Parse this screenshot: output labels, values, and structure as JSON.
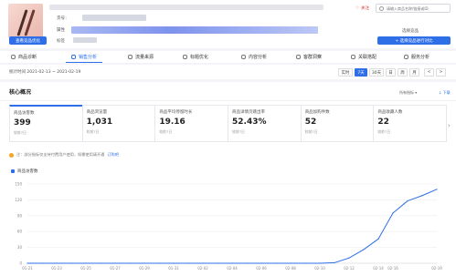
{
  "header": {
    "product_id_label": "货号：",
    "attr_label": "属性",
    "tag_label": "标签",
    "optimize_btn": "查看竞品优化",
    "follow": "关注",
    "search_placeholder": "请输入商品名称/链接或ID",
    "compare_label": "选择竞品",
    "add_compare_btn": "+ 选择竞品进行对比"
  },
  "tabs": [
    {
      "label": "商品诊断"
    },
    {
      "label": "销售分析",
      "active": true
    },
    {
      "label": "流量来源"
    },
    {
      "label": "标题优化"
    },
    {
      "label": "内容分析"
    },
    {
      "label": "客群洞察"
    },
    {
      "label": "关联搭配"
    },
    {
      "label": "服务分析"
    }
  ],
  "date_range": {
    "text": "统计时间 2021-02-13 ~ 2021-02-19",
    "chips": [
      "实时",
      "7天",
      "30天",
      "日",
      "周",
      "月",
      "<",
      ">"
    ],
    "selected": "7天"
  },
  "core": {
    "title": "核心概况",
    "all_metrics": "所有指标 ▾",
    "download": "↓ 下载",
    "cards": [
      {
        "label": "商品访客数",
        "value": "399",
        "compare": "较前7日"
      },
      {
        "label": "商品浏览量",
        "value": "1,031",
        "compare": "较前7日"
      },
      {
        "label": "商品平均停留时长",
        "value": "19.16",
        "compare": "较前7日"
      },
      {
        "label": "商品详情页跳出率",
        "value": "52.43%",
        "compare": "较前7日"
      },
      {
        "label": "商品加购件数",
        "value": "52",
        "compare": "较前7日"
      },
      {
        "label": "商品收藏人数",
        "value": "22",
        "compare": "较前7日"
      }
    ],
    "notice": "注：部分指标仅支持付费用户使用，如需使用请开通",
    "notice_link": "订购吧"
  },
  "chart_data": {
    "type": "line",
    "series": [
      {
        "name": "商品访客数",
        "color": "#2e6fe8",
        "values": [
          0,
          0,
          0,
          0,
          0,
          0,
          0,
          0,
          0,
          0,
          0,
          0,
          0,
          0,
          0,
          0,
          0,
          0,
          0,
          0,
          0,
          1,
          10,
          26,
          46,
          95,
          118,
          128,
          140
        ]
      }
    ],
    "x": [
      "01-21",
      "01-22",
      "01-23",
      "01-24",
      "01-25",
      "01-26",
      "01-27",
      "01-28",
      "01-29",
      "01-30",
      "01-31",
      "02-01",
      "02-02",
      "02-03",
      "02-04",
      "02-05",
      "02-06",
      "02-07",
      "02-08",
      "02-09",
      "02-10",
      "02-11",
      "02-12",
      "02-13",
      "02-14",
      "02-16",
      "02-17",
      "02-18",
      "02-19"
    ],
    "xticks": [
      "01-21",
      "01-23",
      "01-25",
      "01-27",
      "01-29",
      "01-31",
      "02-02",
      "02-04",
      "02-06",
      "02-08",
      "02-10",
      "02-12",
      "02-14",
      "02-16",
      "02-19"
    ],
    "yticks": [
      0,
      30,
      60,
      90,
      120,
      150
    ],
    "ylim": [
      0,
      150
    ],
    "grid": true
  }
}
